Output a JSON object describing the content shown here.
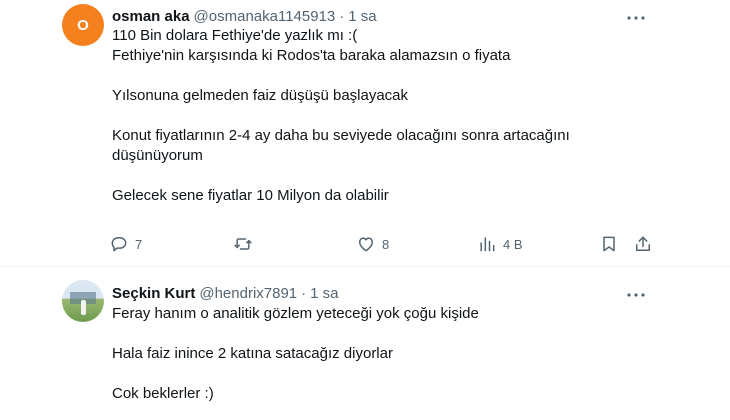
{
  "tweets": [
    {
      "avatar_letter": "O",
      "avatar_color": "#f4801e",
      "name": "osman aka",
      "handle": "@osmanaka1145913",
      "time": "1 sa",
      "lines": [
        "110 Bin dolara Fethiye'de yazlık mı :(",
        "Fethiye'nin karşısında ki Rodos'ta baraka alamazsın o fiyata",
        "",
        "Yılsonuna gelmeden faiz düşüşü başlayacak",
        "",
        "Konut fiyatlarının 2-4 ay daha bu seviyede olacağını sonra artacağını",
        "düşünüyorum",
        "",
        "Gelecek sene fiyatlar 10 Milyon da olabilir"
      ],
      "actions": {
        "reply_icon": "reply-icon",
        "reply_count": "7",
        "retweet_icon": "retweet-icon",
        "like_icon": "heart-icon",
        "like_count": "8",
        "views_icon": "views-icon",
        "views_count": "4 B",
        "bookmark_icon": "bookmark-icon",
        "share_icon": "share-icon"
      }
    },
    {
      "avatar_description_icon": "avatar-photo",
      "name": "Seçkin Kurt",
      "handle": "@hendrix7891",
      "time": "1 sa",
      "lines": [
        "Feray hanım o analitik gözlem yeteceği yok çoğu kişide",
        "",
        "Hala faiz inince 2 katına satacağız diyorlar",
        "",
        "Cok beklerler :)"
      ]
    }
  ],
  "separator_dot": "·",
  "colors": {
    "text": "#0f1419",
    "secondary": "#536471",
    "divider": "#eff3f4",
    "avatar_orange": "#f4801e"
  }
}
